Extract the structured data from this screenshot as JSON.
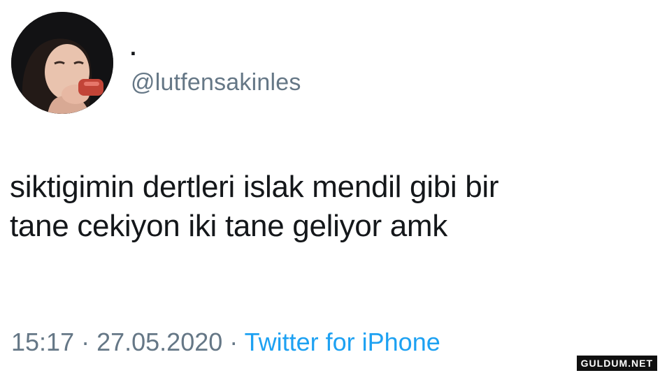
{
  "tweet": {
    "display_name": ".",
    "handle": "@lutfensakinles",
    "text_lines": [
      "siktigimin dertleri islak mendil gibi bir",
      "tane cekiyon iki tane geliyor amk"
    ],
    "time": "15:17",
    "separator": " · ",
    "date": "27.05.2020",
    "source": "Twitter for iPhone"
  },
  "watermark": "GULDUM.NET",
  "colors": {
    "text": "#14171a",
    "secondary": "#657786",
    "link": "#1da1f2"
  }
}
